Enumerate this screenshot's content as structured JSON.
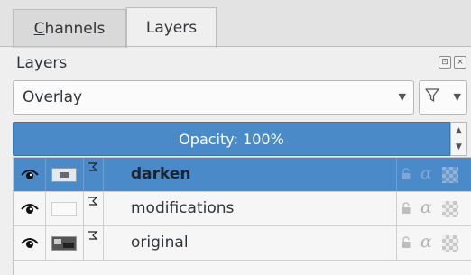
{
  "tabs": [
    {
      "label_pre": "",
      "label_key": "C",
      "label_post": "hannels",
      "active": false
    },
    {
      "label": "Layers",
      "active": true
    }
  ],
  "panel": {
    "title": "Layers"
  },
  "blend_mode": {
    "value": "Overlay"
  },
  "opacity": {
    "text": "Opacity: 100%",
    "value_percent": 100
  },
  "colors": {
    "accent": "#4a8ac9",
    "background": "#efefef",
    "text": "#31363b"
  },
  "layers": [
    {
      "name": "darken",
      "selected": true,
      "visible": true,
      "thumbnail": "dark-thumbnail"
    },
    {
      "name": "modifications",
      "selected": false,
      "visible": true,
      "thumbnail": "blank-thumbnail"
    },
    {
      "name": "original",
      "selected": false,
      "visible": true,
      "thumbnail": "image-thumbnail"
    }
  ],
  "icons": {
    "eye": "eye-icon",
    "chain": "chain-icon",
    "lock": "lock-icon",
    "alpha": "alpha-lock-icon",
    "filter": "filter-icon",
    "checker": "checkerboard-icon"
  },
  "alpha_symbol": "α"
}
